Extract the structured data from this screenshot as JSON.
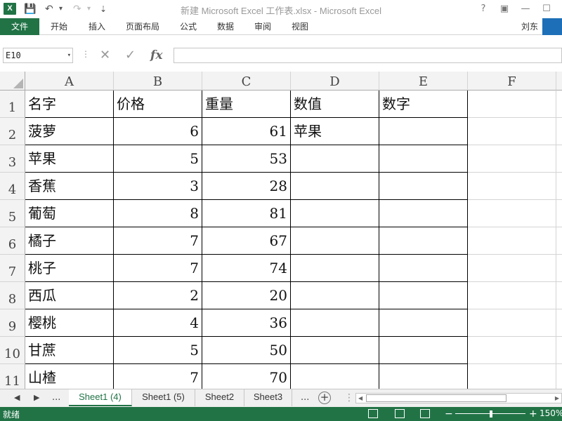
{
  "window": {
    "title": "新建 Microsoft Excel 工作表.xlsx - Microsoft Excel",
    "help": "?",
    "restore": "▣",
    "minimize": "—",
    "maximize": "☐"
  },
  "quick_access": {
    "logo": "X",
    "save_icon": "💾",
    "undo_icon": "↶",
    "undo_dd": "▾",
    "redo_icon": "↷",
    "redo_dd": "▾",
    "more": "⇣"
  },
  "ribbon": {
    "file_tab": "文件",
    "tabs": [
      "开始",
      "插入",
      "页面布局",
      "公式",
      "数据",
      "审阅",
      "视图"
    ],
    "user": "刘东"
  },
  "formula_bar": {
    "name_box": "E10",
    "dd": "▾",
    "sep": "⋮",
    "cancel_icon": "✕",
    "enter_icon": "✓",
    "fx_label": "fx",
    "formula": ""
  },
  "grid": {
    "columns": [
      "A",
      "B",
      "C",
      "D",
      "E",
      "F"
    ],
    "rows": [
      "1",
      "2",
      "3",
      "4",
      "5",
      "6",
      "7",
      "8",
      "9",
      "10",
      "11"
    ],
    "cells": [
      [
        "名字",
        "价格",
        "重量",
        "数值",
        "数字",
        ""
      ],
      [
        "菠萝",
        "6",
        "61",
        "苹果",
        "",
        ""
      ],
      [
        "苹果",
        "5",
        "53",
        "",
        "",
        ""
      ],
      [
        "香蕉",
        "3",
        "28",
        "",
        "",
        ""
      ],
      [
        "葡萄",
        "8",
        "81",
        "",
        "",
        ""
      ],
      [
        "橘子",
        "7",
        "67",
        "",
        "",
        ""
      ],
      [
        "桃子",
        "7",
        "74",
        "",
        "",
        ""
      ],
      [
        "西瓜",
        "2",
        "20",
        "",
        "",
        ""
      ],
      [
        "樱桃",
        "4",
        "36",
        "",
        "",
        ""
      ],
      [
        "甘蔗",
        "5",
        "50",
        "",
        "",
        ""
      ],
      [
        "山楂",
        "7",
        "70",
        "",
        "",
        ""
      ]
    ],
    "selected_cell": "E10"
  },
  "sheets": {
    "nav_prev": "◀",
    "nav_next": "▶",
    "nav_more": "...",
    "tabs": [
      "Sheet1 (4)",
      "Sheet1 (5)",
      "Sheet2",
      "Sheet3"
    ],
    "active": 0,
    "more": "...",
    "add": "+"
  },
  "statusbar": {
    "ready": "就绪",
    "zoom": "150%",
    "zoom_minus": "−",
    "zoom_plus": "+",
    "zoom_level": 0.5
  },
  "colors": {
    "accent": "#217346",
    "win_logo": "#1d6fb8"
  }
}
